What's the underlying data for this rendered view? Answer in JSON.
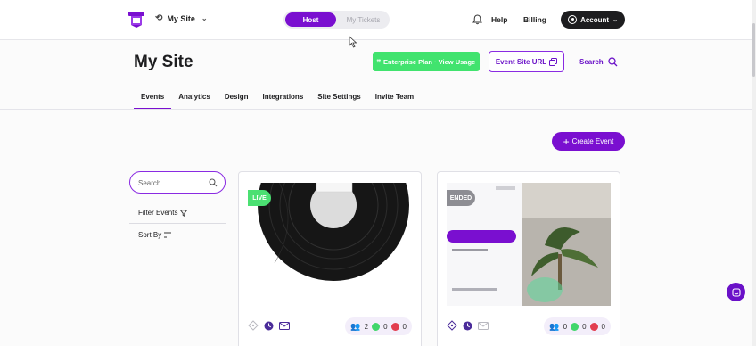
{
  "header": {
    "site_name": "My Site",
    "segment": {
      "host": "Host",
      "tickets": "My Tickets"
    },
    "help": "Help",
    "billing": "Billing",
    "account": "Account"
  },
  "page": {
    "title": "My Site",
    "plan_button": "Enterprise Plan · View Usage",
    "url_button": "Event Site URL",
    "search_label": "Search"
  },
  "tabs": [
    {
      "label": "Events"
    },
    {
      "label": "Analytics"
    },
    {
      "label": "Design"
    },
    {
      "label": "Integrations"
    },
    {
      "label": "Site Settings"
    },
    {
      "label": "Invite Team"
    }
  ],
  "create_event": "Create Event",
  "sidebar": {
    "search_placeholder": "Search",
    "filter_label": "Filter Events",
    "sort_label": "Sort By"
  },
  "events": [
    {
      "badge": "LIVE",
      "stats": {
        "attendees": "2",
        "accepted": "0",
        "rejected": "0"
      }
    },
    {
      "badge": "ENDED",
      "stats": {
        "attendees": "0",
        "accepted": "0",
        "rejected": "0"
      }
    }
  ],
  "colors": {
    "accent": "#7a0fd0",
    "plan_green": "#41e36e",
    "live_green": "#4be072",
    "ended_gray": "#8d8d93"
  }
}
